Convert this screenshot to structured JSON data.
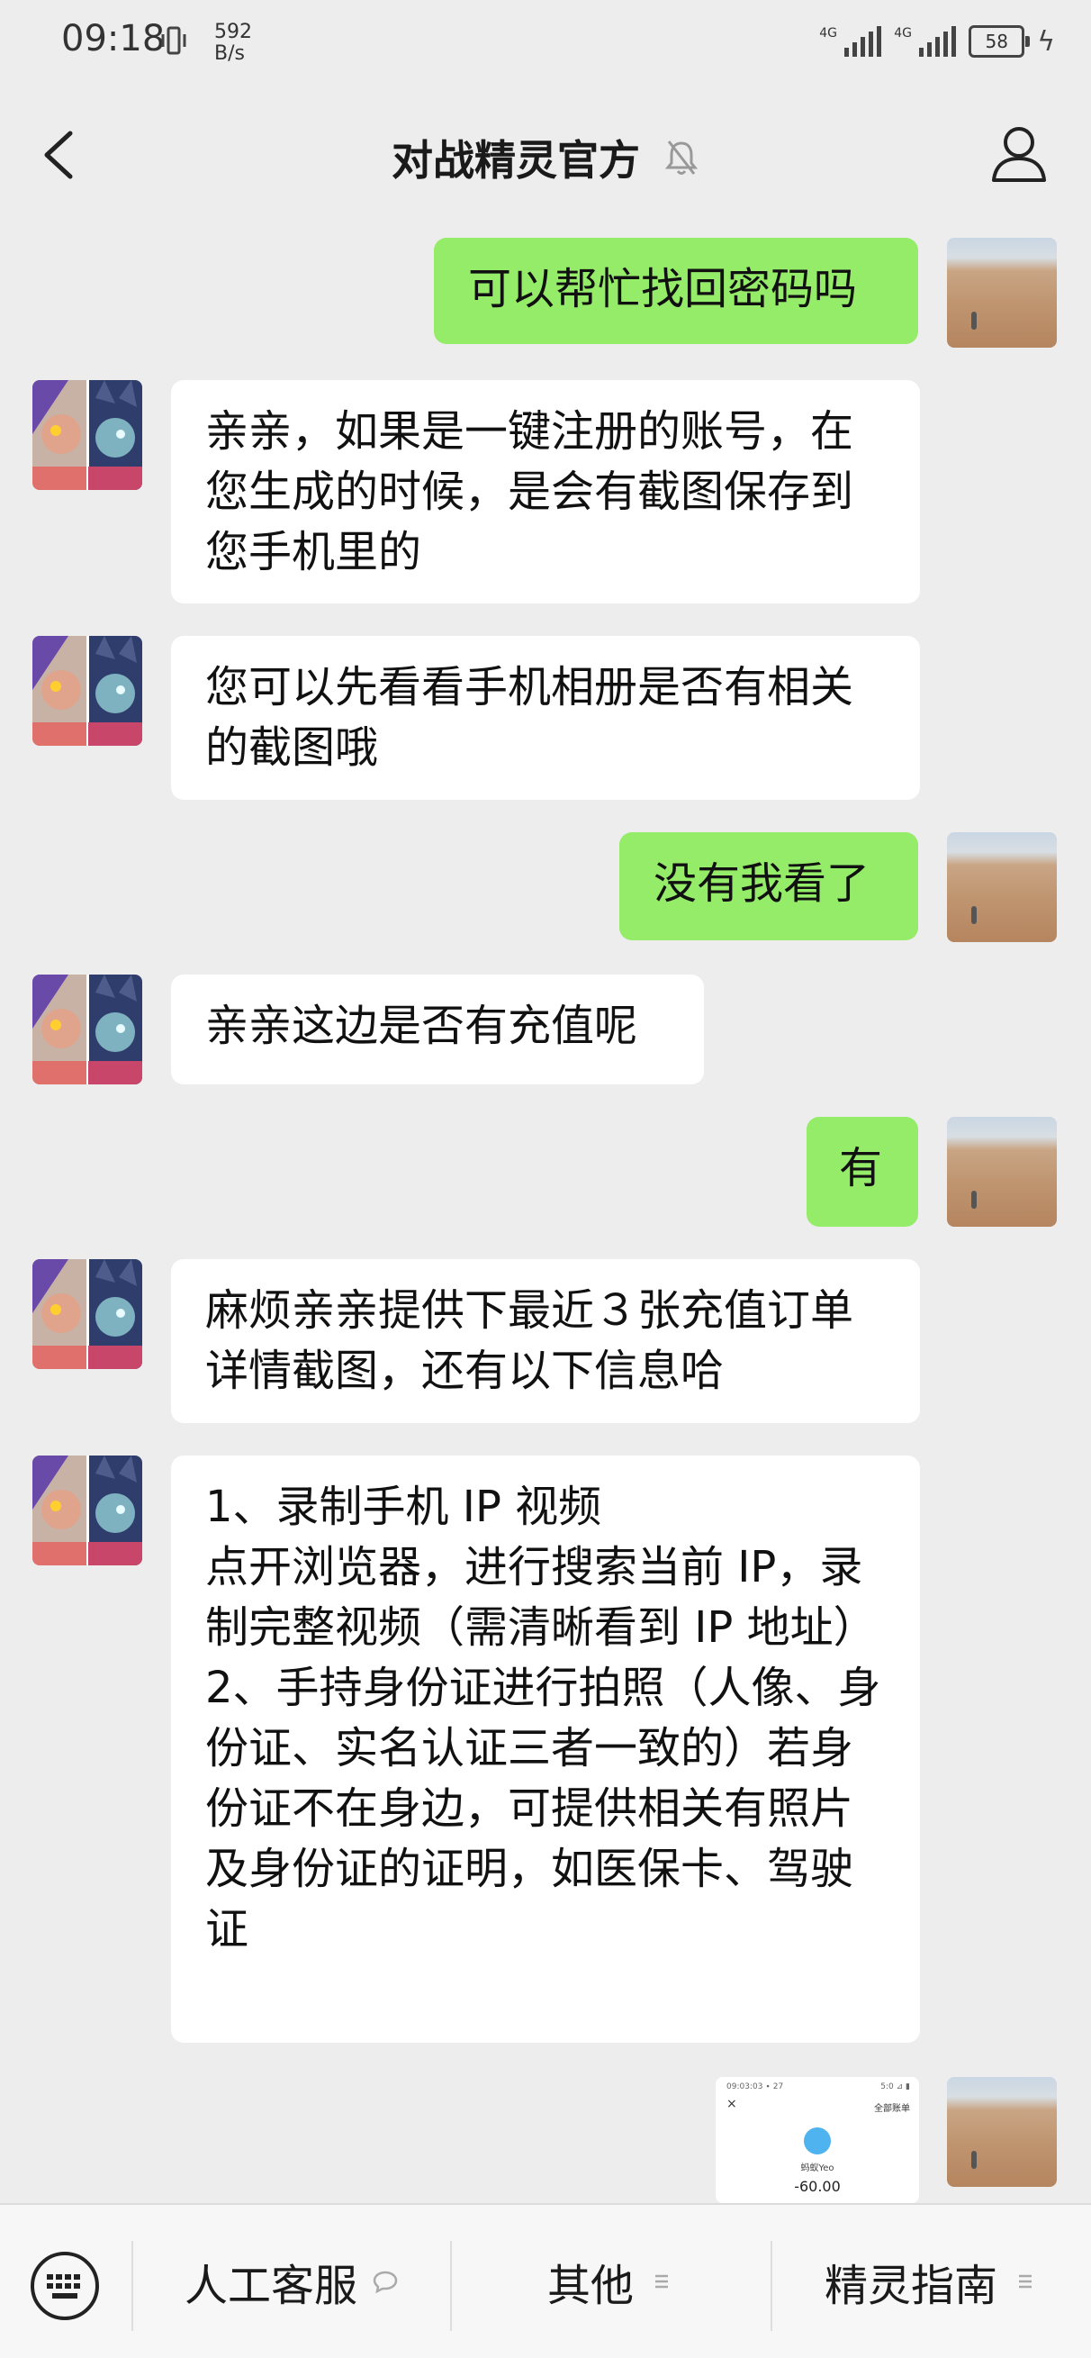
{
  "status": {
    "time": "09:18",
    "speed_value": "592",
    "speed_unit": "B/s",
    "sim1": "4G",
    "sim2": "4G",
    "battery": "58"
  },
  "header": {
    "title": "对战精灵官方"
  },
  "messages": [
    {
      "side": "right",
      "text": "可以帮忙找回密码吗"
    },
    {
      "side": "left",
      "text": "亲亲，如果是一键注册的账号，在您生成的时候，是会有截图保存到您手机里的"
    },
    {
      "side": "left",
      "text": "您可以先看看手机相册是否有相关的截图哦"
    },
    {
      "side": "right",
      "text": "没有我看了"
    },
    {
      "side": "left",
      "text": "亲亲这边是否有充值呢"
    },
    {
      "side": "right",
      "text": "有"
    },
    {
      "side": "left",
      "text": "麻烦亲亲提供下最近３张充值订单详情截图，还有以下信息哈"
    },
    {
      "side": "left",
      "text": "1、录制手机 IP 视频\n点开浏览器，进行搜索当前 IP，录制完整视频（需清晰看到 IP 地址）\n2、手持身份证进行拍照（人像、身份证、实名认证三者一致的）若身份证不在身边，可提供相关有照片及身份证的证明，如医保卡、驾驶证"
    }
  ],
  "image_message": {
    "top_left": "09:03:03 ∙ 27",
    "top_right": "5:0 ⊿ ▮",
    "close": "×",
    "bill_link": "全部账单",
    "merchant": "蚂蚁Yeo",
    "amount": "-60.00"
  },
  "bottom_bar": {
    "tabs": [
      "人工客服",
      "其他",
      "精灵指南"
    ]
  }
}
